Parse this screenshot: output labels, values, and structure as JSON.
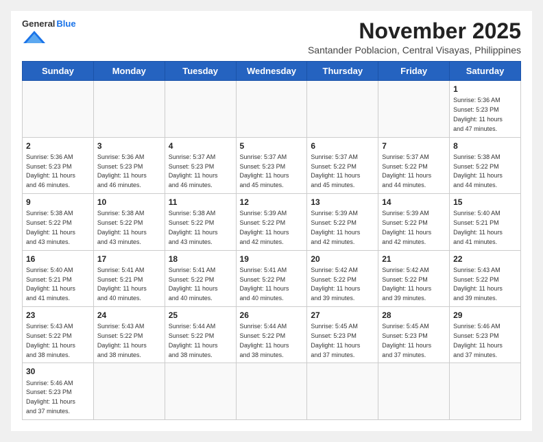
{
  "header": {
    "logo_general": "General",
    "logo_blue": "Blue",
    "month_title": "November 2025",
    "subtitle": "Santander Poblacion, Central Visayas, Philippines"
  },
  "weekdays": [
    "Sunday",
    "Monday",
    "Tuesday",
    "Wednesday",
    "Thursday",
    "Friday",
    "Saturday"
  ],
  "days": [
    {
      "date": 1,
      "sunrise": "5:36 AM",
      "sunset": "5:23 PM",
      "daylight_hours": 11,
      "daylight_minutes": 47,
      "col": 6
    },
    {
      "date": 2,
      "sunrise": "5:36 AM",
      "sunset": "5:23 PM",
      "daylight_hours": 11,
      "daylight_minutes": 46,
      "col": 0
    },
    {
      "date": 3,
      "sunrise": "5:36 AM",
      "sunset": "5:23 PM",
      "daylight_hours": 11,
      "daylight_minutes": 46,
      "col": 1
    },
    {
      "date": 4,
      "sunrise": "5:37 AM",
      "sunset": "5:23 PM",
      "daylight_hours": 11,
      "daylight_minutes": 46,
      "col": 2
    },
    {
      "date": 5,
      "sunrise": "5:37 AM",
      "sunset": "5:23 PM",
      "daylight_hours": 11,
      "daylight_minutes": 45,
      "col": 3
    },
    {
      "date": 6,
      "sunrise": "5:37 AM",
      "sunset": "5:22 PM",
      "daylight_hours": 11,
      "daylight_minutes": 45,
      "col": 4
    },
    {
      "date": 7,
      "sunrise": "5:37 AM",
      "sunset": "5:22 PM",
      "daylight_hours": 11,
      "daylight_minutes": 44,
      "col": 5
    },
    {
      "date": 8,
      "sunrise": "5:38 AM",
      "sunset": "5:22 PM",
      "daylight_hours": 11,
      "daylight_minutes": 44,
      "col": 6
    },
    {
      "date": 9,
      "sunrise": "5:38 AM",
      "sunset": "5:22 PM",
      "daylight_hours": 11,
      "daylight_minutes": 43,
      "col": 0
    },
    {
      "date": 10,
      "sunrise": "5:38 AM",
      "sunset": "5:22 PM",
      "daylight_hours": 11,
      "daylight_minutes": 43,
      "col": 1
    },
    {
      "date": 11,
      "sunrise": "5:38 AM",
      "sunset": "5:22 PM",
      "daylight_hours": 11,
      "daylight_minutes": 43,
      "col": 2
    },
    {
      "date": 12,
      "sunrise": "5:39 AM",
      "sunset": "5:22 PM",
      "daylight_hours": 11,
      "daylight_minutes": 42,
      "col": 3
    },
    {
      "date": 13,
      "sunrise": "5:39 AM",
      "sunset": "5:22 PM",
      "daylight_hours": 11,
      "daylight_minutes": 42,
      "col": 4
    },
    {
      "date": 14,
      "sunrise": "5:39 AM",
      "sunset": "5:22 PM",
      "daylight_hours": 11,
      "daylight_minutes": 42,
      "col": 5
    },
    {
      "date": 15,
      "sunrise": "5:40 AM",
      "sunset": "5:21 PM",
      "daylight_hours": 11,
      "daylight_minutes": 41,
      "col": 6
    },
    {
      "date": 16,
      "sunrise": "5:40 AM",
      "sunset": "5:21 PM",
      "daylight_hours": 11,
      "daylight_minutes": 41,
      "col": 0
    },
    {
      "date": 17,
      "sunrise": "5:41 AM",
      "sunset": "5:21 PM",
      "daylight_hours": 11,
      "daylight_minutes": 40,
      "col": 1
    },
    {
      "date": 18,
      "sunrise": "5:41 AM",
      "sunset": "5:22 PM",
      "daylight_hours": 11,
      "daylight_minutes": 40,
      "col": 2
    },
    {
      "date": 19,
      "sunrise": "5:41 AM",
      "sunset": "5:22 PM",
      "daylight_hours": 11,
      "daylight_minutes": 40,
      "col": 3
    },
    {
      "date": 20,
      "sunrise": "5:42 AM",
      "sunset": "5:22 PM",
      "daylight_hours": 11,
      "daylight_minutes": 39,
      "col": 4
    },
    {
      "date": 21,
      "sunrise": "5:42 AM",
      "sunset": "5:22 PM",
      "daylight_hours": 11,
      "daylight_minutes": 39,
      "col": 5
    },
    {
      "date": 22,
      "sunrise": "5:43 AM",
      "sunset": "5:22 PM",
      "daylight_hours": 11,
      "daylight_minutes": 39,
      "col": 6
    },
    {
      "date": 23,
      "sunrise": "5:43 AM",
      "sunset": "5:22 PM",
      "daylight_hours": 11,
      "daylight_minutes": 38,
      "col": 0
    },
    {
      "date": 24,
      "sunrise": "5:43 AM",
      "sunset": "5:22 PM",
      "daylight_hours": 11,
      "daylight_minutes": 38,
      "col": 1
    },
    {
      "date": 25,
      "sunrise": "5:44 AM",
      "sunset": "5:22 PM",
      "daylight_hours": 11,
      "daylight_minutes": 38,
      "col": 2
    },
    {
      "date": 26,
      "sunrise": "5:44 AM",
      "sunset": "5:22 PM",
      "daylight_hours": 11,
      "daylight_minutes": 38,
      "col": 3
    },
    {
      "date": 27,
      "sunrise": "5:45 AM",
      "sunset": "5:23 PM",
      "daylight_hours": 11,
      "daylight_minutes": 37,
      "col": 4
    },
    {
      "date": 28,
      "sunrise": "5:45 AM",
      "sunset": "5:23 PM",
      "daylight_hours": 11,
      "daylight_minutes": 37,
      "col": 5
    },
    {
      "date": 29,
      "sunrise": "5:46 AM",
      "sunset": "5:23 PM",
      "daylight_hours": 11,
      "daylight_minutes": 37,
      "col": 6
    },
    {
      "date": 30,
      "sunrise": "5:46 AM",
      "sunset": "5:23 PM",
      "daylight_hours": 11,
      "daylight_minutes": 37,
      "col": 0
    }
  ],
  "labels": {
    "sunrise": "Sunrise:",
    "sunset": "Sunset:",
    "daylight": "Daylight: 11 hours"
  }
}
